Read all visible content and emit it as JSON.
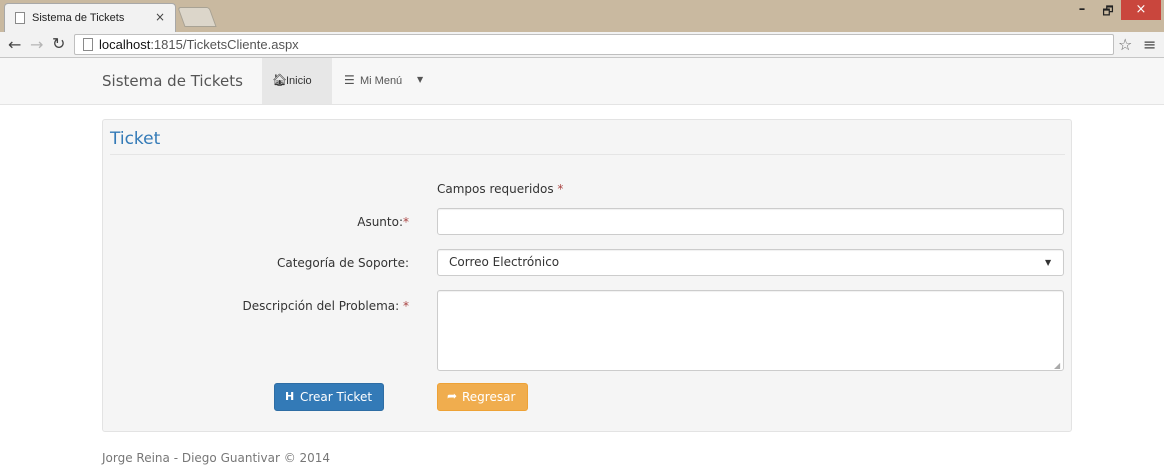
{
  "browser": {
    "tab_title": "Sistema de Tickets",
    "tab_close": "×",
    "url_host": "localhost",
    "url_rest": ":1815/TicketsCliente.aspx",
    "window_controls": {
      "minimize": "–",
      "maximize": "🗗",
      "close": "×"
    },
    "icons": {
      "back": "arrow-left-icon",
      "forward": "arrow-right-icon",
      "reload": "reload-icon",
      "star": "star-icon",
      "menu": "hamburger-icon"
    }
  },
  "navbar": {
    "brand": "Sistema de Tickets",
    "items": [
      {
        "label": "Inicio",
        "icon": "home-icon",
        "active": true
      },
      {
        "label": "Mi Menú",
        "icon": "list-icon",
        "dropdown": true
      }
    ]
  },
  "panel": {
    "title": "Ticket",
    "required_note": "Campos requeridos",
    "required_mark": "*",
    "fields": {
      "asunto": {
        "label": "Asunto:",
        "required": true,
        "value": ""
      },
      "categoria": {
        "label": "Categoría de Soporte:",
        "selected": "Correo Electrónico"
      },
      "descripcion": {
        "label": "Descripción del Problema:",
        "required": true,
        "value": ""
      }
    },
    "buttons": {
      "crear": {
        "label": "Crear Ticket",
        "icon": "save-icon",
        "color": "#337ab7"
      },
      "regresar": {
        "label": "Regresar",
        "icon": "share-arrow-icon",
        "color": "#f0ad4e"
      }
    }
  },
  "footer": {
    "text": "Jorge Reina - Diego Guantivar © 2014"
  },
  "colors": {
    "primary": "#337ab7",
    "warning": "#f0ad4e",
    "required": "#a94442",
    "title": "#337ab7"
  }
}
